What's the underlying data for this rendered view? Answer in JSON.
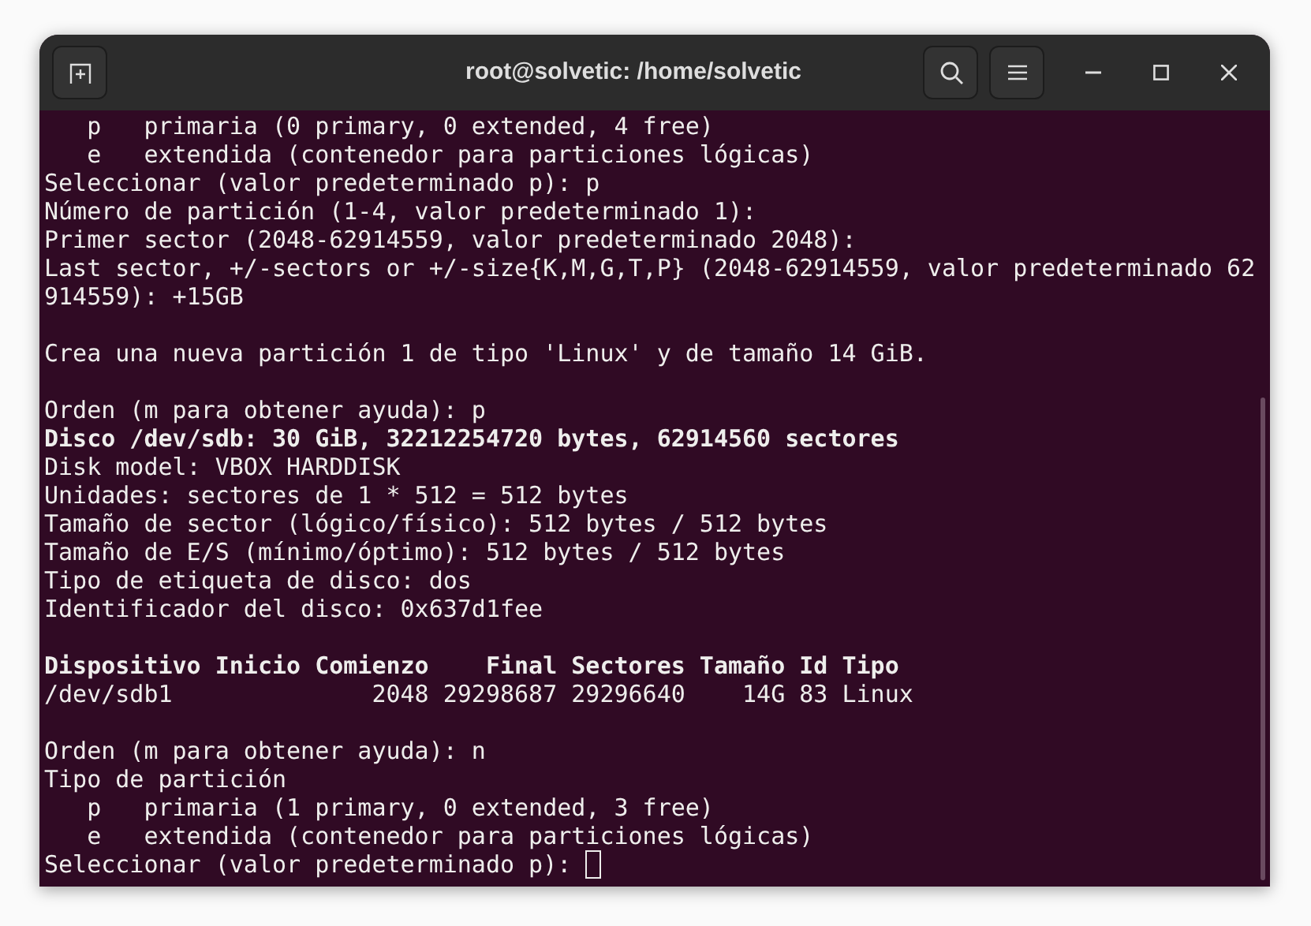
{
  "window": {
    "title": "root@solvetic: /home/solvetic"
  },
  "terminal": {
    "lines": [
      {
        "kind": "text",
        "text": "   p   primaria (0 primary, 0 extended, 4 free)"
      },
      {
        "kind": "text",
        "text": "   e   extendida (contenedor para particiones lógicas)"
      },
      {
        "kind": "text",
        "text": "Seleccionar (valor predeterminado p): p"
      },
      {
        "kind": "text",
        "text": "Número de partición (1-4, valor predeterminado 1):"
      },
      {
        "kind": "text",
        "text": "Primer sector (2048-62914559, valor predeterminado 2048):"
      },
      {
        "kind": "text",
        "text": "Last sector, +/-sectors or +/-size{K,M,G,T,P} (2048-62914559, valor predeterminado 62"
      },
      {
        "kind": "text",
        "text": "914559): +15GB"
      },
      {
        "kind": "blank"
      },
      {
        "kind": "text",
        "text": "Crea una nueva partición 1 de tipo 'Linux' y de tamaño 14 GiB."
      },
      {
        "kind": "blank"
      },
      {
        "kind": "text",
        "text": "Orden (m para obtener ayuda): p"
      },
      {
        "kind": "bold",
        "text": "Disco /dev/sdb: 30 GiB, 32212254720 bytes, 62914560 sectores"
      },
      {
        "kind": "text",
        "text": "Disk model: VBOX HARDDISK"
      },
      {
        "kind": "text",
        "text": "Unidades: sectores de 1 * 512 = 512 bytes"
      },
      {
        "kind": "text",
        "text": "Tamaño de sector (lógico/físico): 512 bytes / 512 bytes"
      },
      {
        "kind": "text",
        "text": "Tamaño de E/S (mínimo/óptimo): 512 bytes / 512 bytes"
      },
      {
        "kind": "text",
        "text": "Tipo de etiqueta de disco: dos"
      },
      {
        "kind": "text",
        "text": "Identificador del disco: 0x637d1fee"
      },
      {
        "kind": "blank"
      },
      {
        "kind": "bold",
        "text": "Dispositivo Inicio Comienzo    Final Sectores Tamaño Id Tipo"
      },
      {
        "kind": "text",
        "text": "/dev/sdb1              2048 29298687 29296640    14G 83 Linux"
      },
      {
        "kind": "blank"
      },
      {
        "kind": "text",
        "text": "Orden (m para obtener ayuda): n"
      },
      {
        "kind": "text",
        "text": "Tipo de partición"
      },
      {
        "kind": "text",
        "text": "   p   primaria (1 primary, 0 extended, 3 free)"
      },
      {
        "kind": "text",
        "text": "   e   extendida (contenedor para particiones lógicas)"
      },
      {
        "kind": "prompt",
        "text": "Seleccionar (valor predeterminado p): "
      }
    ]
  }
}
